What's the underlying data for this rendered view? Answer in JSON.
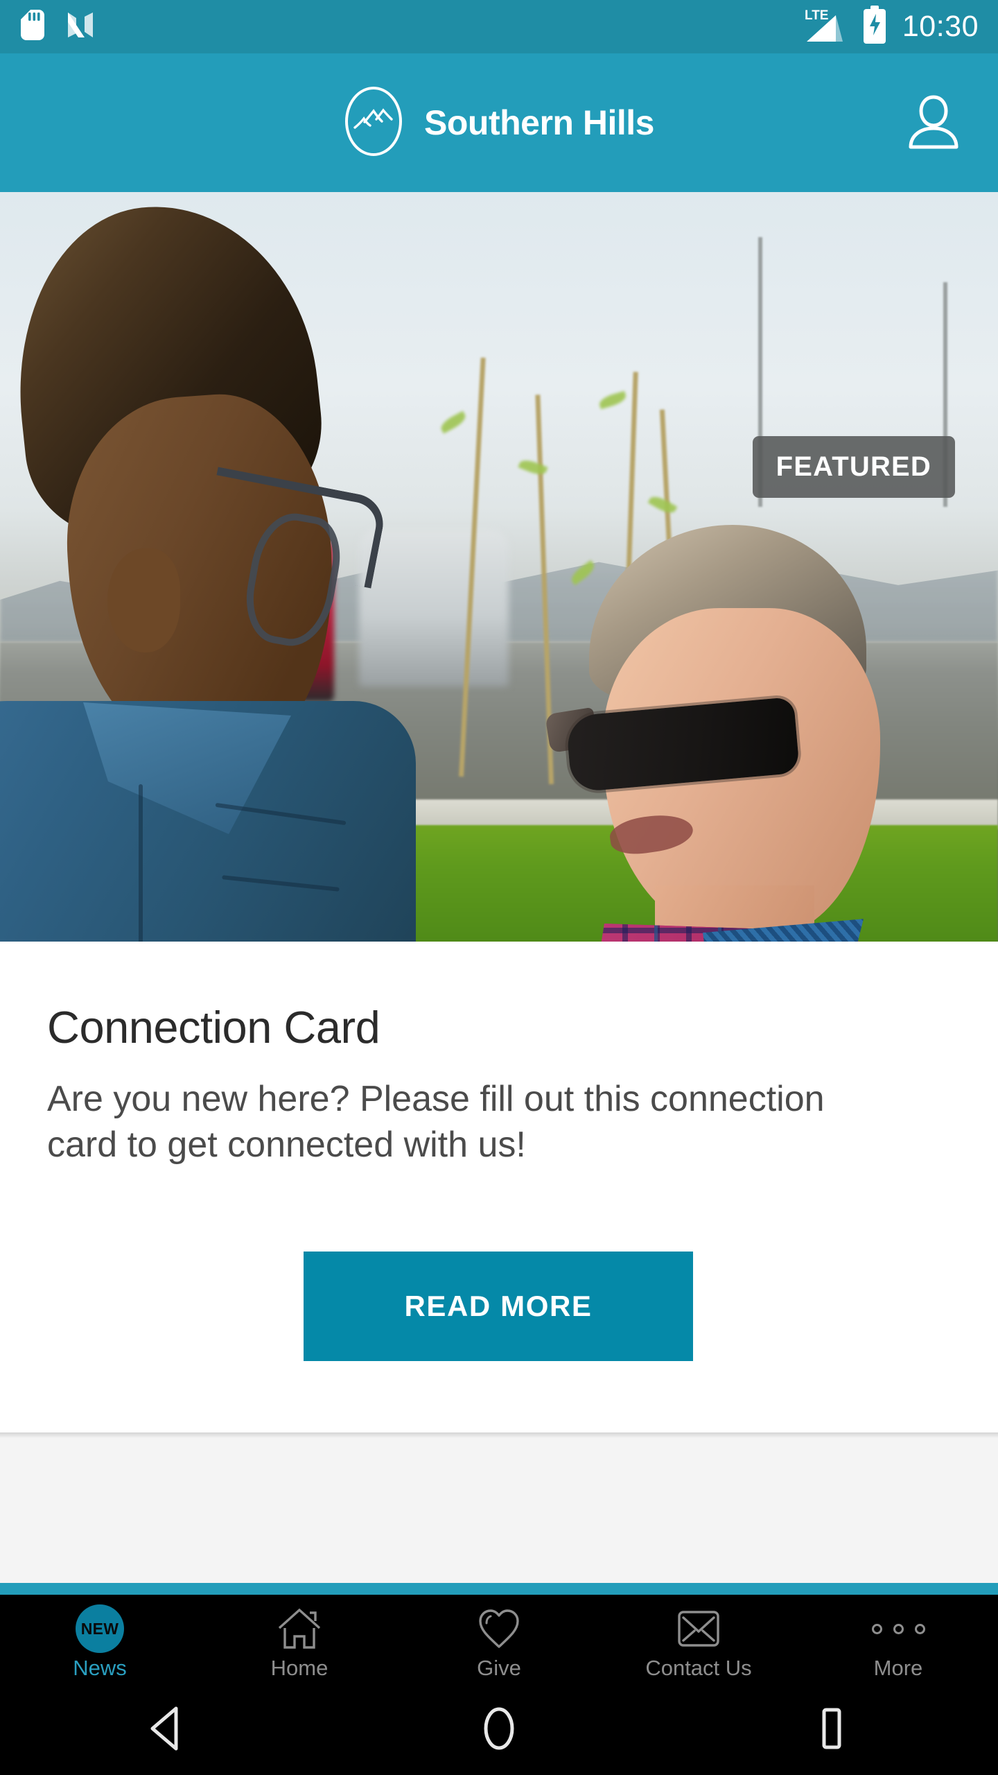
{
  "status_bar": {
    "icons": [
      "sd-card-icon",
      "nfc-n-icon"
    ],
    "network_label": "LTE",
    "signal_icon": "signal-bars-icon",
    "battery_icon": "battery-charging-icon",
    "time": "10:30",
    "background_color": "#1f8da5"
  },
  "app_bar": {
    "logo_icon": "southern-hills-mountain-logo",
    "title": "Southern Hills",
    "profile_icon": "person-outline-icon",
    "background_color": "#239dba"
  },
  "feature": {
    "badge_label": "FEATURED",
    "badge_color": "#555858",
    "image_alt": "Two men talking outdoors in a parking lot"
  },
  "card": {
    "title": "Connection Card",
    "body": "Are you new here? Please fill out this connection card to get connected with us!",
    "button_label": "READ MORE",
    "button_color": "#0589a8"
  },
  "tab_bar": {
    "active_color": "#2a9fc0",
    "inactive_color": "#8e8e8e",
    "items": [
      {
        "label": "News",
        "icon": "new-badge-icon",
        "badge_text": "NEW",
        "active": true
      },
      {
        "label": "Home",
        "icon": "house-outline-icon",
        "active": false
      },
      {
        "label": "Give",
        "icon": "heart-outline-icon",
        "active": false
      },
      {
        "label": "Contact Us",
        "icon": "envelope-outline-icon",
        "active": false
      },
      {
        "label": "More",
        "icon": "three-dots-icon",
        "active": false
      }
    ]
  },
  "android_nav": {
    "back_icon": "back-triangle-icon",
    "home_icon": "home-circle-icon",
    "recents_icon": "recents-square-icon"
  }
}
